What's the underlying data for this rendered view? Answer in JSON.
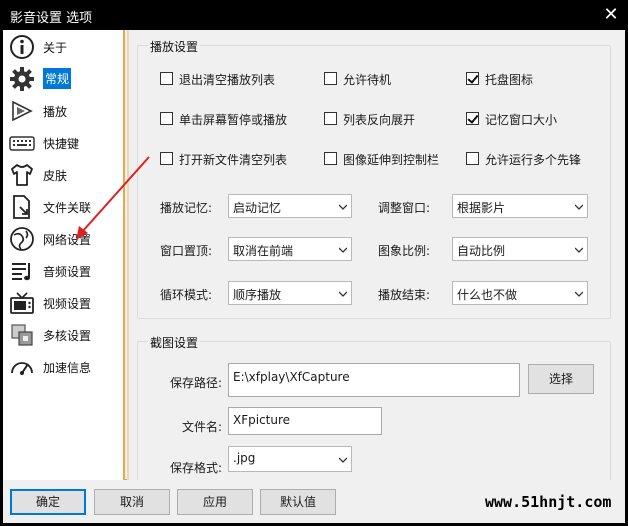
{
  "window": {
    "title": "影音设置 选项",
    "close_glyph": "✕"
  },
  "sidebar": {
    "items": [
      {
        "label": "关于",
        "icon": "info-icon"
      },
      {
        "label": "常规",
        "icon": "gear-icon",
        "active": true
      },
      {
        "label": "播放",
        "icon": "play-icon"
      },
      {
        "label": "快捷键",
        "icon": "keyboard-icon"
      },
      {
        "label": "皮肤",
        "icon": "shirt-icon"
      },
      {
        "label": "文件关联",
        "icon": "file-link-icon"
      },
      {
        "label": "网络设置",
        "icon": "network-icon"
      },
      {
        "label": "音频设置",
        "icon": "audio-icon"
      },
      {
        "label": "视频设置",
        "icon": "tv-icon"
      },
      {
        "label": "多核设置",
        "icon": "multicore-icon"
      },
      {
        "label": "加速信息",
        "icon": "speed-icon"
      }
    ]
  },
  "playback": {
    "title": "播放设置",
    "checkboxes": [
      {
        "label": "退出清空播放列表",
        "checked": false
      },
      {
        "label": "允许待机",
        "checked": false
      },
      {
        "label": "托盘图标",
        "checked": true
      },
      {
        "label": "单击屏幕暂停或播放",
        "checked": false
      },
      {
        "label": "列表反向展开",
        "checked": false
      },
      {
        "label": "记忆窗口大小",
        "checked": true
      },
      {
        "label": "打开新文件清空列表",
        "checked": false
      },
      {
        "label": "图像延伸到控制栏",
        "checked": false
      },
      {
        "label": "允许运行多个先锋",
        "checked": false
      }
    ],
    "selects": [
      {
        "label": "播放记忆:",
        "value": "启动记忆"
      },
      {
        "label": "调整窗口:",
        "value": "根据影片"
      },
      {
        "label": "窗口置顶:",
        "value": "取消在前端"
      },
      {
        "label": "图象比例:",
        "value": "自动比例"
      },
      {
        "label": "循环模式:",
        "value": "顺序播放"
      },
      {
        "label": "播放结束:",
        "value": "什么也不做"
      }
    ]
  },
  "capture": {
    "title": "截图设置",
    "path_label": "保存路径:",
    "path_value": "E:\\xfplay\\XfCapture",
    "browse_label": "选择",
    "filename_label": "文件名:",
    "filename_value": "XFpicture",
    "format_label": "保存格式:",
    "format_value": ".jpg"
  },
  "footer": {
    "ok_label": "确定",
    "cancel_label": "取消",
    "apply_label": "应用",
    "default_label": "默认值",
    "watermark": "www.51hnjt.com"
  },
  "colors": {
    "accent": "#0078d7",
    "sidebar_border": "#e8a84a",
    "annotation_arrow": "#e02020"
  }
}
